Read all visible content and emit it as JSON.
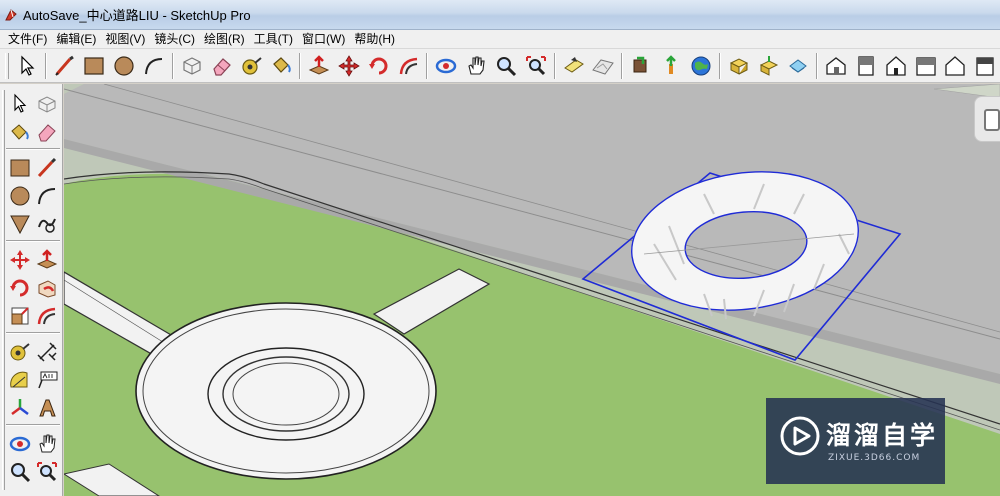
{
  "window": {
    "title": "AutoSave_中心道路LIU - SketchUp Pro"
  },
  "menu": {
    "items": [
      "文件(F)",
      "编辑(E)",
      "视图(V)",
      "镜头(C)",
      "绘图(R)",
      "工具(T)",
      "窗口(W)",
      "帮助(H)"
    ]
  },
  "toolbar": {
    "tools": [
      "select-icon",
      "line-pencil-icon",
      "rectangle-icon",
      "circle-icon",
      "arc-icon",
      "make-component-icon",
      "eraser-icon",
      "tape-measure-icon",
      "paint-bucket-icon",
      "push-pull-icon",
      "move-icon",
      "rotate-icon",
      "offset-icon",
      "orbit-icon",
      "pan-icon",
      "zoom-icon",
      "zoom-extents-icon",
      "add-location-icon",
      "toggle-terrain-icon",
      "get-models-icon",
      "share-model-icon",
      "google-earth-icon",
      "get-components-icon",
      "share-component-icon",
      "send-to-layout-icon",
      "iso-view-icon",
      "top-view-icon",
      "front-view-icon",
      "right-view-icon",
      "back-view-icon",
      "left-view-icon"
    ]
  },
  "palette": {
    "tools": [
      "select-icon",
      "make-component-icon",
      "paint-bucket-icon",
      "eraser-icon",
      "rectangle-icon",
      "line-pencil-icon",
      "circle-icon",
      "arc-icon",
      "polygon-icon",
      "freehand-icon",
      "move-icon",
      "push-pull-icon",
      "rotate-icon",
      "follow-me-icon",
      "scale-icon",
      "offset-icon",
      "tape-measure-icon",
      "dimension-icon",
      "protractor-icon",
      "text-icon",
      "axes-icon",
      "3d-text-icon",
      "orbit-icon",
      "pan-icon",
      "zoom-icon",
      "zoom-window-icon"
    ]
  },
  "watermark": {
    "name": "溜溜自学",
    "url": "ZIXUE.3D66.COM"
  },
  "colors": {
    "road": "#b9b9b9",
    "lawn": "#97c26e",
    "sky": "#bfc8b8",
    "selection": "#1f2bd6",
    "watermark_bg": "#263252"
  }
}
